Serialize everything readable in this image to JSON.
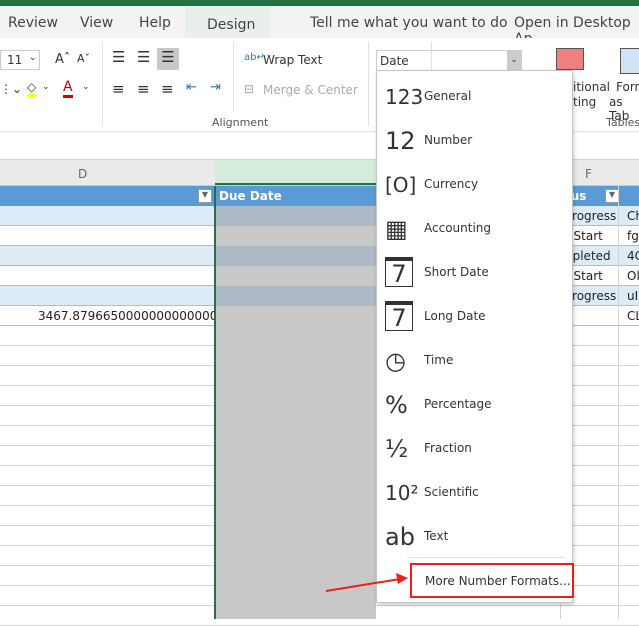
{
  "tabs": [
    "Review",
    "View",
    "Help",
    "Design",
    "Tell me what you want to do",
    "Open in Desktop Ap"
  ],
  "ribbon": {
    "font_size": "11",
    "wrap_text": "Wrap Text",
    "merge_center": "Merge & Center",
    "alignment_label": "Alignment",
    "number_format": "Date",
    "conditional": "itional",
    "conditional2": "ting",
    "format_table": "Form",
    "format_table2": "as Tab",
    "tables_label": "Tables"
  },
  "columns": {
    "d": "D",
    "f": "F"
  },
  "table": {
    "due_date": "Due Date",
    "status": "tus",
    "d_value": "3467.87966500000000000000",
    "status_rows": [
      "Progress",
      "t Start",
      "npleted",
      "t Start",
      "Progress",
      ""
    ],
    "g_rows": [
      "Ch",
      "fg",
      "4C",
      "Ol",
      "uI",
      "CL"
    ]
  },
  "menu": {
    "items": [
      {
        "icon": "general-icon",
        "glyph": "123",
        "label": "General"
      },
      {
        "icon": "number-icon",
        "glyph": "12",
        "label": "Number"
      },
      {
        "icon": "currency-icon",
        "glyph": "[O]",
        "label": "Currency"
      },
      {
        "icon": "accounting-icon",
        "glyph": "▦",
        "label": "Accounting"
      },
      {
        "icon": "short-date-icon",
        "glyph": "7",
        "label": "Short Date"
      },
      {
        "icon": "long-date-icon",
        "glyph": "7",
        "label": "Long Date"
      },
      {
        "icon": "time-icon",
        "glyph": "◷",
        "label": "Time"
      },
      {
        "icon": "percentage-icon",
        "glyph": "%",
        "label": "Percentage"
      },
      {
        "icon": "fraction-icon",
        "glyph": "½",
        "label": "Fraction"
      },
      {
        "icon": "scientific-icon",
        "glyph": "10²",
        "label": "Scientific"
      },
      {
        "icon": "text-icon",
        "glyph": "ab",
        "label": "Text"
      }
    ],
    "more": "More Number Formats..."
  },
  "colors": {
    "excel_green": "#217346",
    "table_header": "#5b9bd5",
    "band": "#ddebf7",
    "highlight": "#e8221b"
  }
}
